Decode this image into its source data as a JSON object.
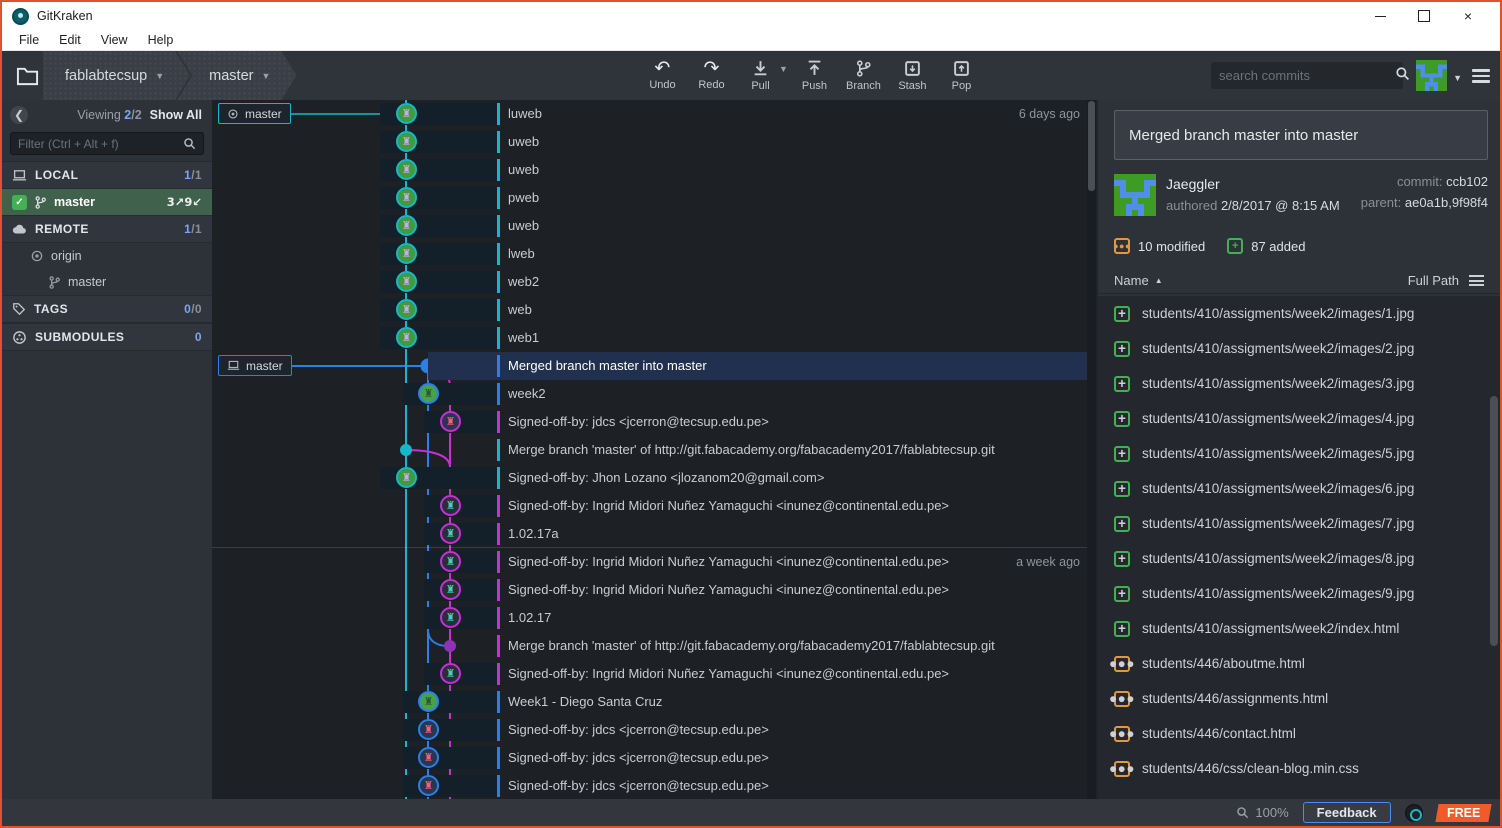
{
  "colors": {
    "teal": "#19b6c9",
    "blue": "#2a7fe8",
    "magenta": "#c92fd4",
    "purple": "#9031b8",
    "green": "#43b054",
    "orange": "#e0993f",
    "accent": "#f15a29",
    "rowsel": "#22304f",
    "selgreen": "#40614c",
    "winborder": "#e0512d"
  },
  "titlebar": {
    "app": "GitKraken"
  },
  "menu": {
    "items": [
      "File",
      "Edit",
      "View",
      "Help"
    ]
  },
  "toolbar": {
    "repo": "fablabtecsup",
    "branch": "master",
    "buttons": [
      "Undo",
      "Redo",
      "Pull",
      "Push",
      "Branch",
      "Stash",
      "Pop"
    ],
    "search_placeholder": "search commits"
  },
  "sidebar": {
    "viewing_label": "Viewing",
    "viewing_current": "2",
    "viewing_total": "/2",
    "show_all": "Show All",
    "filter_placeholder": "Filter (Ctrl + Alt + f)",
    "local": {
      "label": "LOCAL",
      "count": "1",
      "total": "/1"
    },
    "local_branch": {
      "name": "master",
      "ahead_behind": "3↗9↙"
    },
    "remote": {
      "label": "REMOTE",
      "count": "1",
      "total": "/1"
    },
    "origin": "origin",
    "remote_branch": "master",
    "tags": {
      "label": "TAGS",
      "count": "0",
      "total": "/0"
    },
    "submodules": {
      "label": "SUBMODULES",
      "count": "0"
    }
  },
  "graph": {
    "remote_ref": "master",
    "local_ref": "master",
    "commits": [
      {
        "m": "luweb",
        "c": 1,
        "n": "a",
        "av": "jaeggler",
        "date": "6 days ago"
      },
      {
        "m": "uweb",
        "c": 1,
        "n": "a",
        "av": "jaeggler"
      },
      {
        "m": "uweb",
        "c": 1,
        "n": "a",
        "av": "jaeggler"
      },
      {
        "m": "pweb",
        "c": 1,
        "n": "a",
        "av": "jaeggler"
      },
      {
        "m": "uweb",
        "c": 1,
        "n": "a",
        "av": "jaeggler"
      },
      {
        "m": "lweb",
        "c": 1,
        "n": "a",
        "av": "jaeggler"
      },
      {
        "m": "web2",
        "c": 1,
        "n": "a",
        "av": "jaeggler"
      },
      {
        "m": "web",
        "c": 1,
        "n": "a",
        "av": "jaeggler"
      },
      {
        "m": "web1",
        "c": 1,
        "n": "a",
        "av": "jaeggler"
      },
      {
        "m": "Merged branch master into master",
        "c": 2,
        "n": "d",
        "dot": "blue",
        "sel": true
      },
      {
        "m": "week2",
        "c": 2,
        "n": "a",
        "av": "green"
      },
      {
        "m": "Signed-off-by: jdcs <jcerron@tecsup.edu.pe>",
        "c": 3,
        "n": "a",
        "av": "pink"
      },
      {
        "m": "Merge branch 'master' of http://git.fabacademy.org/fabacademy2017/fablabtecsup.git",
        "c": 1,
        "n": "d",
        "dot": "teal"
      },
      {
        "m": "Signed-off-by: Jhon Lozano <jlozanom20@gmail.com>",
        "c": 1,
        "n": "a",
        "av": "jaeggler"
      },
      {
        "m": "Signed-off-by: Ingrid Midori Nuñez Yamaguchi <inunez@continental.edu.pe>",
        "c": 3,
        "n": "a",
        "av": "teal"
      },
      {
        "m": "1.02.17a",
        "c": 3,
        "n": "a",
        "av": "teal"
      },
      {
        "m": "Signed-off-by: Ingrid Midori Nuñez Yamaguchi <inunez@continental.edu.pe>",
        "c": 3,
        "n": "a",
        "av": "teal",
        "date": "a week ago",
        "sep": true
      },
      {
        "m": "Signed-off-by: Ingrid Midori Nuñez Yamaguchi <inunez@continental.edu.pe>",
        "c": 3,
        "n": "a",
        "av": "teal"
      },
      {
        "m": "1.02.17",
        "c": 3,
        "n": "a",
        "av": "teal"
      },
      {
        "m": "Merge branch 'master' of http://git.fabacademy.org/fabacademy2017/fablabtecsup.git",
        "c": 3,
        "n": "d",
        "dot": "purple"
      },
      {
        "m": "Signed-off-by: Ingrid Midori Nuñez Yamaguchi <inunez@continental.edu.pe>",
        "c": 3,
        "n": "a",
        "av": "teal"
      },
      {
        "m": "Week1 - Diego Santa Cruz",
        "c": 2,
        "n": "a",
        "av": "green"
      },
      {
        "m": "Signed-off-by: jdcs <jcerron@tecsup.edu.pe>",
        "c": 2,
        "n": "a",
        "av": "pink"
      },
      {
        "m": "Signed-off-by: jdcs <jcerron@tecsup.edu.pe>",
        "c": 2,
        "n": "a",
        "av": "pink"
      },
      {
        "m": "Signed-off-by: jdcs <jcerron@tecsup.edu.pe>",
        "c": 2,
        "n": "a",
        "av": "pink"
      }
    ]
  },
  "commit_panel": {
    "message": "Merged branch master into master",
    "author": "Jaeggler",
    "authored_label": "authored",
    "authored_date": "2/8/2017 @ 8:15 AM",
    "commit_label": "commit:",
    "commit_sha": "ccb102",
    "parent_label": "parent:",
    "parent_sha": "ae0a1b,9f98f4",
    "modified_stat": "10 modified",
    "added_stat": "87 added",
    "name_header": "Name",
    "fullpath_header": "Full Path",
    "files": [
      {
        "path": "students/410/assigments/week2/images/1.jpg",
        "status": "added"
      },
      {
        "path": "students/410/assigments/week2/images/2.jpg",
        "status": "added"
      },
      {
        "path": "students/410/assigments/week2/images/3.jpg",
        "status": "added"
      },
      {
        "path": "students/410/assigments/week2/images/4.jpg",
        "status": "added"
      },
      {
        "path": "students/410/assigments/week2/images/5.jpg",
        "status": "added"
      },
      {
        "path": "students/410/assigments/week2/images/6.jpg",
        "status": "added"
      },
      {
        "path": "students/410/assigments/week2/images/7.jpg",
        "status": "added"
      },
      {
        "path": "students/410/assigments/week2/images/8.jpg",
        "status": "added"
      },
      {
        "path": "students/410/assigments/week2/images/9.jpg",
        "status": "added"
      },
      {
        "path": "students/410/assigments/week2/index.html",
        "status": "added"
      },
      {
        "path": "students/446/aboutme.html",
        "status": "modified"
      },
      {
        "path": "students/446/assignments.html",
        "status": "modified"
      },
      {
        "path": "students/446/contact.html",
        "status": "modified"
      },
      {
        "path": "students/446/css/clean-blog.min.css",
        "status": "modified"
      }
    ]
  },
  "statusbar": {
    "zoom": "100%",
    "feedback": "Feedback",
    "plan": "FREE"
  }
}
